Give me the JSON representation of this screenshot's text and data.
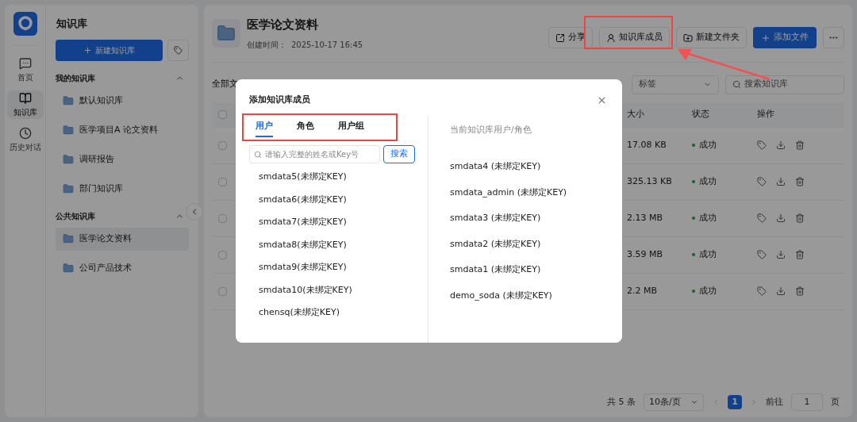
{
  "rail": [
    {
      "label": "首页",
      "kind": "chat",
      "selected": false
    },
    {
      "label": "知识库",
      "kind": "book",
      "selected": true
    },
    {
      "label": "历史对话",
      "kind": "history",
      "selected": false
    }
  ],
  "sidebar": {
    "title": "知识库",
    "new_button": "新建知识库",
    "groups": [
      {
        "title": "我的知识库",
        "expanded": true,
        "items": [
          {
            "label": "默认知识库",
            "selected": false
          },
          {
            "label": "医学项目A 论文资料",
            "selected": false
          },
          {
            "label": "调研报告",
            "selected": false
          },
          {
            "label": "部门知识库",
            "selected": false
          }
        ]
      },
      {
        "title": "公共知识库",
        "expanded": true,
        "items": [
          {
            "label": "医学论文资料",
            "selected": true
          },
          {
            "label": "公司产品技术",
            "selected": false
          }
        ]
      }
    ]
  },
  "header": {
    "title": "医学论文资料",
    "created_label": "创建时间：",
    "created": "2025-10-17 16:45",
    "buttons": [
      {
        "label": "分享",
        "kind": "share"
      },
      {
        "label": "知识库成员",
        "kind": "members"
      },
      {
        "label": "新建文件夹",
        "kind": "folder"
      },
      {
        "label": "添加文件",
        "kind": "primary"
      }
    ]
  },
  "toolbar": {
    "filter_label": "全部文",
    "tag_select": "标签",
    "search_placeholder": "搜索知识库"
  },
  "table": {
    "all_checked": false,
    "columns": [
      "大小",
      "状态",
      "操作"
    ],
    "rows": [
      {
        "size": "17.08 KB",
        "status": "成功",
        "checked": false
      },
      {
        "size": "325.13 KB",
        "status": "成功",
        "checked": false
      },
      {
        "size": "2.13 MB",
        "status": "成功",
        "checked": false
      },
      {
        "size": "3.59 MB",
        "status": "成功",
        "checked": false
      },
      {
        "size": "2.2 MB",
        "status": "成功",
        "checked": false
      }
    ]
  },
  "pagination": {
    "total": "共 5 条",
    "page_size": "10条/页",
    "pages": [
      {
        "label": "1",
        "selected": true
      }
    ],
    "goto_label": "前往",
    "goto_value": "1",
    "goto_unit": "页"
  },
  "modal": {
    "title": "添加知识库成员",
    "tabs": [
      {
        "label": "用户",
        "selected": true
      },
      {
        "label": "角色",
        "selected": false
      },
      {
        "label": "用户组",
        "selected": false
      }
    ],
    "search_placeholder": "请输入完整的姓名或Key号",
    "search_button": "搜索",
    "candidates": [
      "smdata5(未绑定KEY)",
      "smdata6(未绑定KEY)",
      "smdata7(未绑定KEY)",
      "smdata8(未绑定KEY)",
      "smdata9(未绑定KEY)",
      "smdata10(未绑定KEY)",
      "chensq(未绑定KEY)"
    ],
    "current_title": "当前知识库用户/角色",
    "current": [
      "smdata4 (未绑定KEY)",
      "smdata_admin (未绑定KEY)",
      "smdata3 (未绑定KEY)",
      "smdata2 (未绑定KEY)",
      "smdata1 (未绑定KEY)",
      "demo_soda (未绑定KEY)"
    ]
  }
}
